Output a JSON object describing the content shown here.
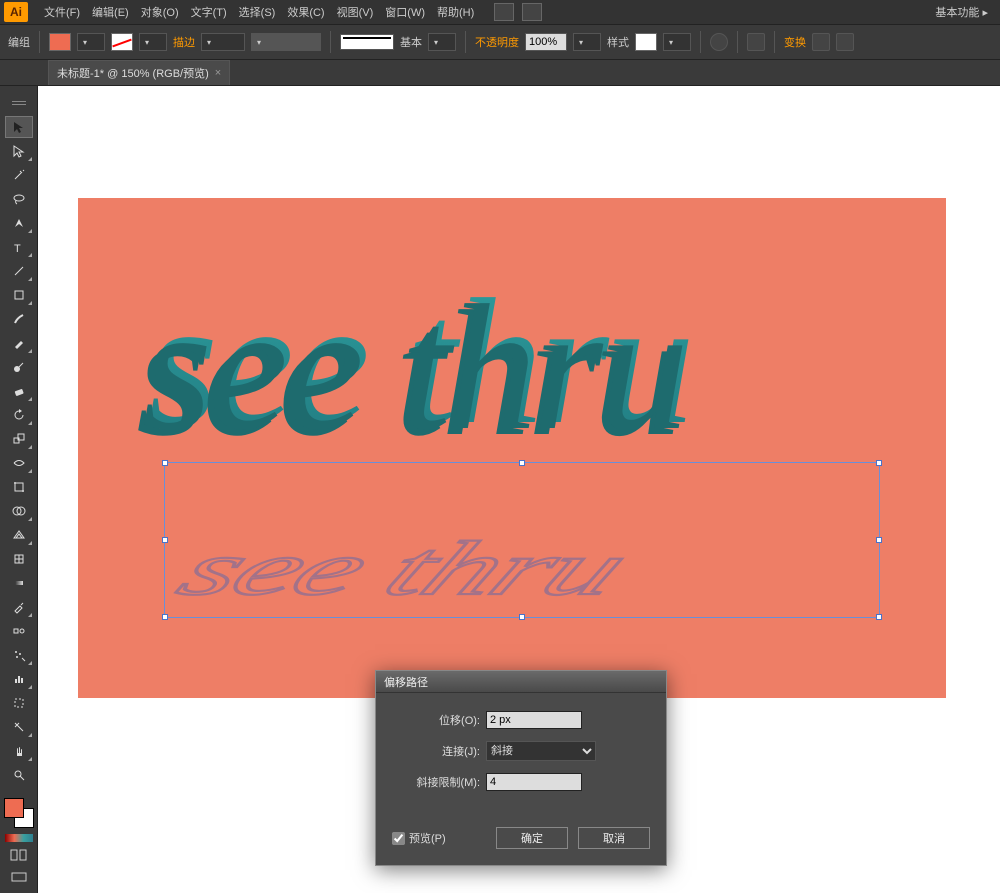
{
  "app": {
    "logo": "Ai"
  },
  "menu": {
    "file": "文件(F)",
    "edit": "编辑(E)",
    "object": "对象(O)",
    "type": "文字(T)",
    "select": "选择(S)",
    "effect": "效果(C)",
    "view": "视图(V)",
    "window": "窗口(W)",
    "help": "帮助(H)",
    "workspace": "基本功能",
    "workspace_arrow": "▸"
  },
  "options": {
    "selection_label": "编组",
    "stroke_label": "描边",
    "stroke_weight": "",
    "brush_label": "基本",
    "opacity_label": "不透明度",
    "opacity_value": "100%",
    "style_label": "样式",
    "transform_label": "变换",
    "fill_color": "#ee6c52"
  },
  "tab": {
    "title": "未标题-1* @ 150% (RGB/预览)",
    "close": "×"
  },
  "artwork": {
    "main_text": "see thru",
    "shadow_text": "see thru"
  },
  "dialog": {
    "title": "偏移路径",
    "offset_label": "位移(O):",
    "offset_value": "2 px",
    "join_label": "连接(J):",
    "join_value": "斜接",
    "miter_label": "斜接限制(M):",
    "miter_value": "4",
    "preview_label": "预览(P)",
    "ok": "确定",
    "cancel": "取消"
  },
  "tools": [
    "selection",
    "direct-selection",
    "magic-wand",
    "lasso",
    "pen",
    "type",
    "line",
    "rectangle",
    "paintbrush",
    "pencil",
    "blob",
    "eraser",
    "rotate",
    "scale",
    "width",
    "free-transform",
    "shape-builder",
    "perspective",
    "mesh",
    "gradients",
    "eyedropper",
    "blend",
    "symbol-sprayer",
    "graph",
    "artboard",
    "slice",
    "hand",
    "zoom"
  ]
}
